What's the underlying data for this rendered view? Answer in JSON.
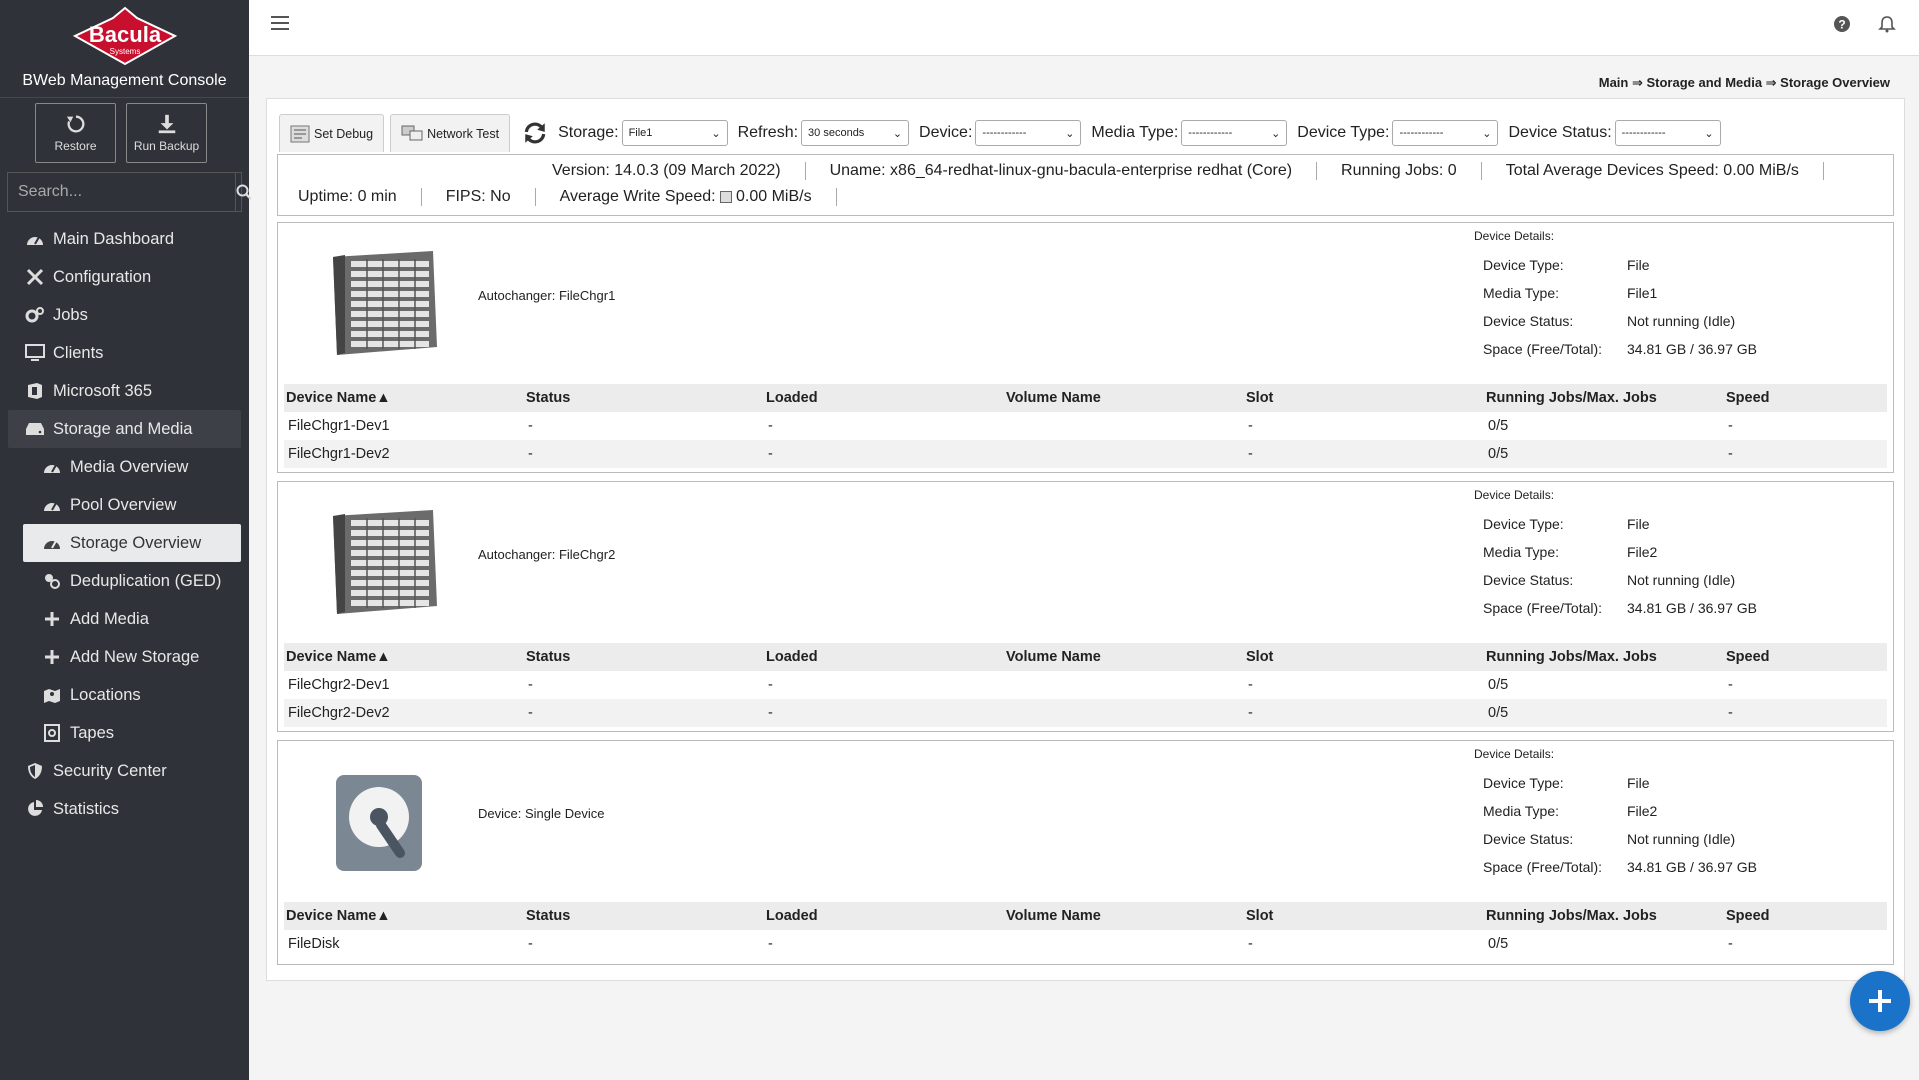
{
  "brand": {
    "logo_text": "Bacula",
    "logo_sub": "Systems",
    "title": "BWeb Management Console"
  },
  "quick_actions": [
    {
      "label": "Restore",
      "icon": "restore-icon"
    },
    {
      "label": "Run Backup",
      "icon": "download-icon"
    }
  ],
  "search": {
    "placeholder": "Search..."
  },
  "nav": [
    {
      "label": "Main Dashboard",
      "icon": "dashboard-icon"
    },
    {
      "label": "Configuration",
      "icon": "tools-icon"
    },
    {
      "label": "Jobs",
      "icon": "gears-icon"
    },
    {
      "label": "Clients",
      "icon": "monitor-icon"
    },
    {
      "label": "Microsoft 365",
      "icon": "office-icon"
    },
    {
      "label": "Storage and Media",
      "icon": "hdd-icon"
    },
    {
      "label": "Media Overview",
      "icon": "dashboard-icon"
    },
    {
      "label": "Pool Overview",
      "icon": "dashboard-icon"
    },
    {
      "label": "Storage Overview",
      "icon": "dashboard-icon"
    },
    {
      "label": "Deduplication (GED)",
      "icon": "dedup-icon"
    },
    {
      "label": "Add Media",
      "icon": "plus-icon"
    },
    {
      "label": "Add New Storage",
      "icon": "plus-icon"
    },
    {
      "label": "Locations",
      "icon": "map-icon"
    },
    {
      "label": "Tapes",
      "icon": "tape-icon"
    },
    {
      "label": "Security Center",
      "icon": "shield-icon"
    },
    {
      "label": "Statistics",
      "icon": "pie-chart-icon"
    }
  ],
  "breadcrumb": "Main ⇒ Storage and Media ⇒ Storage Overview",
  "toolbar": {
    "set_debug": "Set Debug",
    "network_test": "Network Test",
    "storage_label": "Storage:",
    "storage_value": "File1",
    "refresh_label": "Refresh:",
    "refresh_value": "30 seconds",
    "device_label": "Device:",
    "device_value": "------------",
    "media_type_label": "Media Type:",
    "media_type_value": "------------",
    "device_type_label": "Device Type:",
    "device_type_value": "------------",
    "device_status_label": "Device Status:",
    "device_status_value": "------------"
  },
  "info": {
    "version": "Version: 14.0.3 (09 March 2022)",
    "uname": "Uname: x86_64-redhat-linux-gnu-bacula-enterprise redhat (Core)",
    "running_jobs": "Running Jobs: 0",
    "total_speed": "Total Average Devices Speed: 0.00 MiB/s",
    "uptime": "Uptime: 0 min",
    "fips": "FIPS: No",
    "avg_write_label": "Average Write Speed:",
    "avg_write_value": "0.00 MiB/s"
  },
  "table_headers": [
    "Device Name▲",
    "Status",
    "Loaded",
    "Volume Name",
    "Slot",
    "Running Jobs/Max. Jobs",
    "Speed"
  ],
  "detail_labels": {
    "title": "Device Details:",
    "device_type": "Device Type:",
    "media_type": "Media Type:",
    "device_status": "Device Status:",
    "space": "Space (Free/Total):"
  },
  "storages": [
    {
      "label": "Autochanger: FileChgr1",
      "kind": "autochanger",
      "device_type": "File",
      "media_type": "File1",
      "device_status": "Not running (Idle)",
      "space": "34.81 GB / 36.97 GB",
      "devices": [
        {
          "name": "FileChgr1-Dev1",
          "status": "-",
          "loaded": "-",
          "volume": "",
          "slot": "-",
          "jobs": "0/5",
          "speed": "-"
        },
        {
          "name": "FileChgr1-Dev2",
          "status": "-",
          "loaded": "-",
          "volume": "",
          "slot": "-",
          "jobs": "0/5",
          "speed": "-"
        }
      ]
    },
    {
      "label": "Autochanger: FileChgr2",
      "kind": "autochanger",
      "device_type": "File",
      "media_type": "File2",
      "device_status": "Not running (Idle)",
      "space": "34.81 GB / 36.97 GB",
      "devices": [
        {
          "name": "FileChgr2-Dev1",
          "status": "-",
          "loaded": "-",
          "volume": "",
          "slot": "-",
          "jobs": "0/5",
          "speed": "-"
        },
        {
          "name": "FileChgr2-Dev2",
          "status": "-",
          "loaded": "-",
          "volume": "",
          "slot": "-",
          "jobs": "0/5",
          "speed": "-"
        }
      ]
    },
    {
      "label": "Device: Single Device",
      "kind": "disk",
      "device_type": "File",
      "media_type": "File2",
      "device_status": "Not running (Idle)",
      "space": "34.81 GB / 36.97 GB",
      "devices": [
        {
          "name": "FileDisk",
          "status": "-",
          "loaded": "-",
          "volume": "",
          "slot": "-",
          "jobs": "0/5",
          "speed": "-"
        }
      ]
    }
  ]
}
